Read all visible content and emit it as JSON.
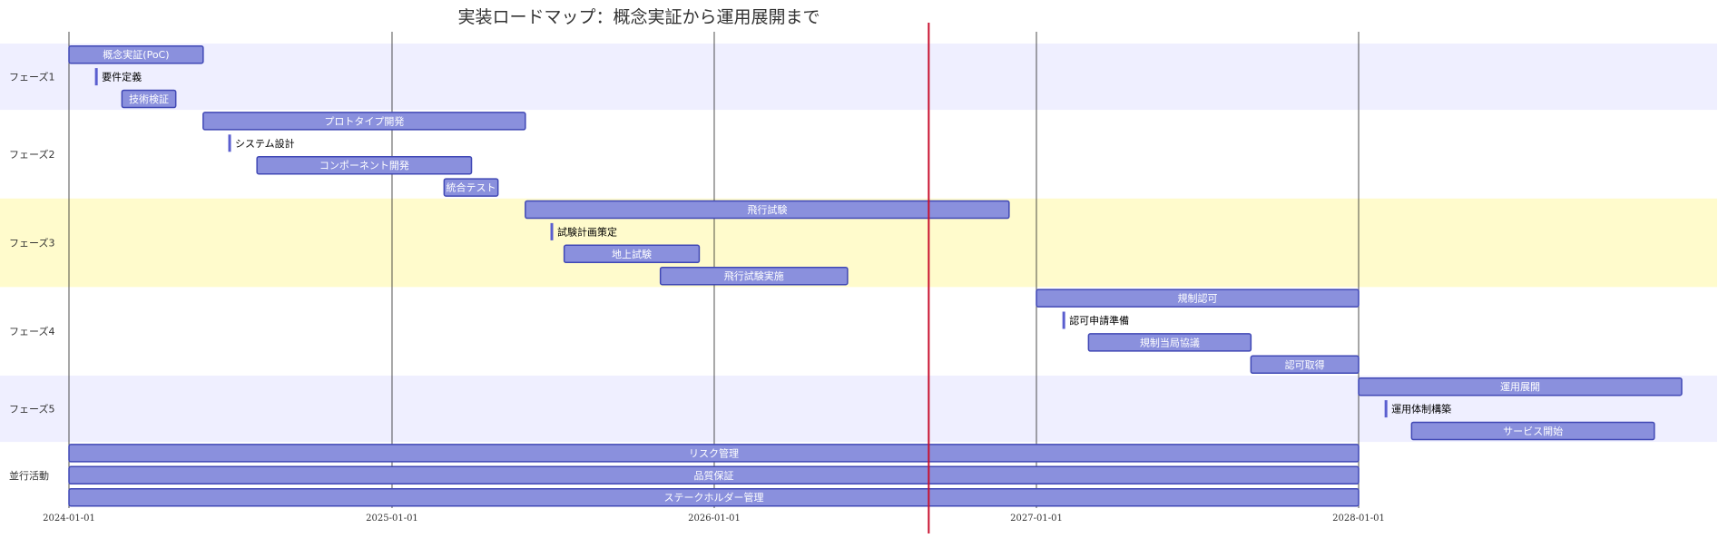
{
  "chart_data": {
    "type": "gantt",
    "title": "実装ロードマップ：概念実証から運用展開まで",
    "x_ticks": [
      "2024-01-01",
      "2025-01-01",
      "2026-01-01",
      "2027-01-01",
      "2028-01-01"
    ],
    "today": "2026-09-01",
    "section_colors": [
      "#efefff",
      "#ffffff",
      "#fffbcc",
      "#ffffff",
      "#efefff",
      "#ffffff"
    ],
    "bar_color": "#8a90dd",
    "bar_stroke": "#4048b5",
    "milestone_color": "#5a5ecf",
    "today_color": "#c8102e",
    "sections": [
      {
        "name": "フェーズ1",
        "tasks": [
          {
            "label": "概念実証(PoC)",
            "start": "2024-01-01",
            "end": "2024-06-01"
          },
          {
            "label": "要件定義",
            "start": "2024-02-01",
            "end": "2024-02-01",
            "milestone": true
          },
          {
            "label": "技術検証",
            "start": "2024-03-01",
            "end": "2024-05-01"
          }
        ]
      },
      {
        "name": "フェーズ2",
        "tasks": [
          {
            "label": "プロトタイプ開発",
            "start": "2024-06-01",
            "end": "2025-06-01"
          },
          {
            "label": "システム設計",
            "start": "2024-07-01",
            "end": "2024-07-01",
            "milestone": true
          },
          {
            "label": "コンポーネント開発",
            "start": "2024-08-01",
            "end": "2025-04-01"
          },
          {
            "label": "統合テスト",
            "start": "2025-03-01",
            "end": "2025-05-01"
          }
        ]
      },
      {
        "name": "フェーズ3",
        "tasks": [
          {
            "label": "飛行試験",
            "start": "2025-06-01",
            "end": "2026-12-01"
          },
          {
            "label": "試験計画策定",
            "start": "2025-07-01",
            "end": "2025-07-01",
            "milestone": true
          },
          {
            "label": "地上試験",
            "start": "2025-07-15",
            "end": "2025-12-15"
          },
          {
            "label": "飛行試験実施",
            "start": "2025-11-01",
            "end": "2026-06-01"
          }
        ]
      },
      {
        "name": "フェーズ4",
        "tasks": [
          {
            "label": "規制認可",
            "start": "2027-01-01",
            "end": "2028-01-01"
          },
          {
            "label": "認可申請準備",
            "start": "2027-02-01",
            "end": "2027-02-01",
            "milestone": true
          },
          {
            "label": "規制当局協議",
            "start": "2027-03-01",
            "end": "2027-09-01"
          },
          {
            "label": "認可取得",
            "start": "2027-09-01",
            "end": "2028-01-01"
          }
        ]
      },
      {
        "name": "フェーズ5",
        "tasks": [
          {
            "label": "運用展開",
            "start": "2028-01-01",
            "end": "2029-01-01"
          },
          {
            "label": "運用体制構築",
            "start": "2028-02-01",
            "end": "2028-02-01",
            "milestone": true
          },
          {
            "label": "サービス開始",
            "start": "2028-03-01",
            "end": "2028-12-01"
          }
        ]
      },
      {
        "name": "並行活動",
        "tasks": [
          {
            "label": "リスク管理",
            "start": "2024-01-01",
            "end": "2028-01-01"
          },
          {
            "label": "品質保証",
            "start": "2024-01-01",
            "end": "2028-01-01"
          },
          {
            "label": "ステークホルダー管理",
            "start": "2024-01-01",
            "end": "2028-01-01"
          }
        ]
      }
    ]
  }
}
